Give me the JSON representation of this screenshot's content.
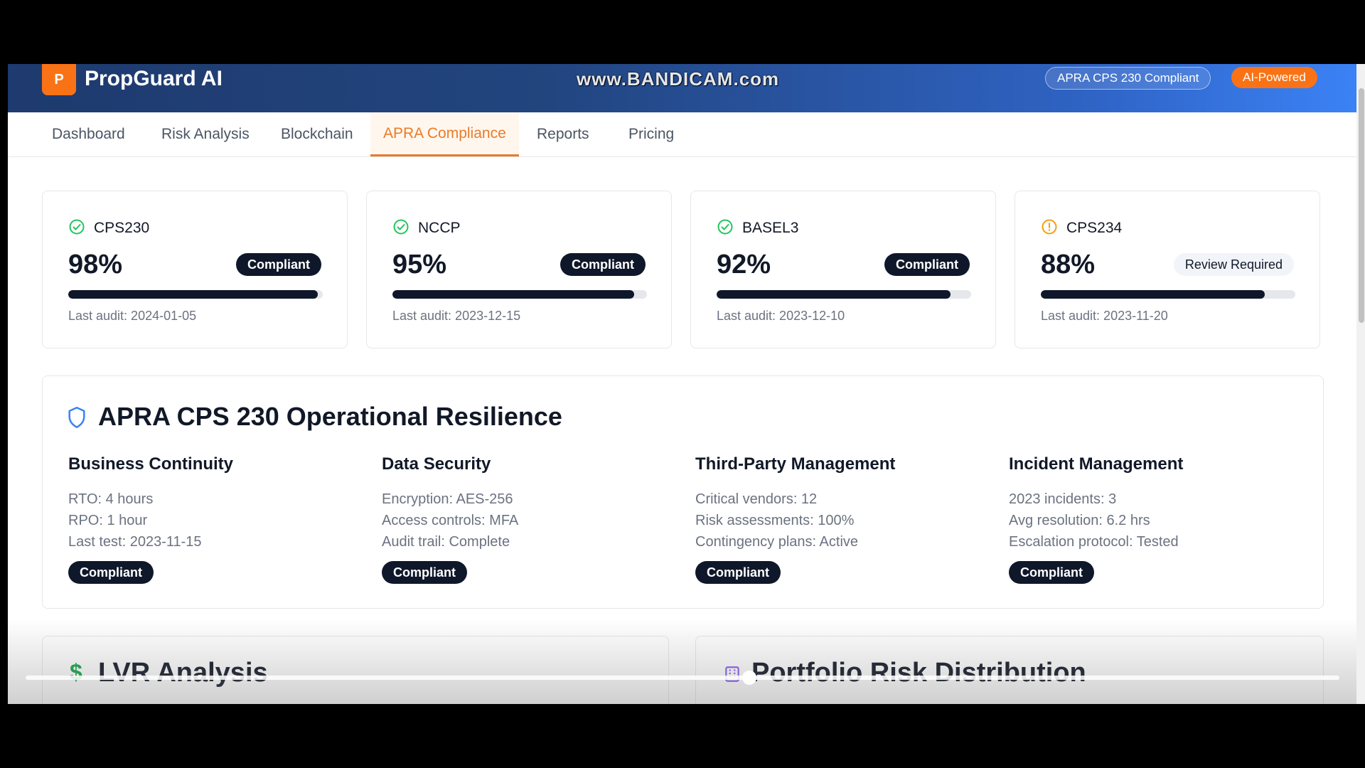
{
  "header": {
    "logo_letter": "P",
    "brand": "PropGuard AI",
    "watermark": "www.BANDICAM.com",
    "badge_apra": "APRA CPS 230 Compliant",
    "badge_ai": "AI-Powered"
  },
  "tabs": [
    {
      "label": "Dashboard",
      "active": false
    },
    {
      "label": "Risk Analysis",
      "active": false
    },
    {
      "label": "Blockchain",
      "active": false
    },
    {
      "label": "APRA Compliance",
      "active": true
    },
    {
      "label": "Reports",
      "active": false
    },
    {
      "label": "Pricing",
      "active": false
    }
  ],
  "metrics": [
    {
      "name": "CPS230",
      "percent": "98%",
      "value": 98,
      "status": "Compliant",
      "audit": "Last audit: 2024-01-05",
      "icon": "check-circle-icon"
    },
    {
      "name": "NCCP",
      "percent": "95%",
      "value": 95,
      "status": "Compliant",
      "audit": "Last audit: 2023-12-15",
      "icon": "check-circle-icon"
    },
    {
      "name": "BASEL3",
      "percent": "92%",
      "value": 92,
      "status": "Compliant",
      "audit": "Last audit: 2023-12-10",
      "icon": "check-circle-icon"
    },
    {
      "name": "CPS234",
      "percent": "88%",
      "value": 88,
      "status": "Review Required",
      "audit": "Last audit: 2023-11-20",
      "icon": "alert-circle-icon"
    }
  ],
  "resilience": {
    "title": "APRA CPS 230 Operational Resilience",
    "columns": [
      {
        "heading": "Business Continuity",
        "lines": [
          "RTO: 4 hours",
          "RPO: 1 hour",
          "Last test: 2023-11-15"
        ],
        "badge": "Compliant"
      },
      {
        "heading": "Data Security",
        "lines": [
          "Encryption: AES-256",
          "Access controls: MFA",
          "Audit trail: Complete"
        ],
        "badge": "Compliant"
      },
      {
        "heading": "Third-Party Management",
        "lines": [
          "Critical vendors: 12",
          "Risk assessments: 100%",
          "Contingency plans: Active"
        ],
        "badge": "Compliant"
      },
      {
        "heading": "Incident Management",
        "lines": [
          "2023 incidents: 3",
          "Avg resolution: 6.2 hrs",
          "Escalation protocol: Tested"
        ],
        "badge": "Compliant"
      }
    ]
  },
  "bottom": {
    "lvr_title": "LVR Analysis",
    "portfolio_title": "Portfolio Risk Distribution"
  },
  "video": {
    "progress": 0.55
  },
  "colors": {
    "accent": "#ea7a2b",
    "success": "#22c55e",
    "warning": "#f59e0b",
    "dark": "#0f172a"
  }
}
